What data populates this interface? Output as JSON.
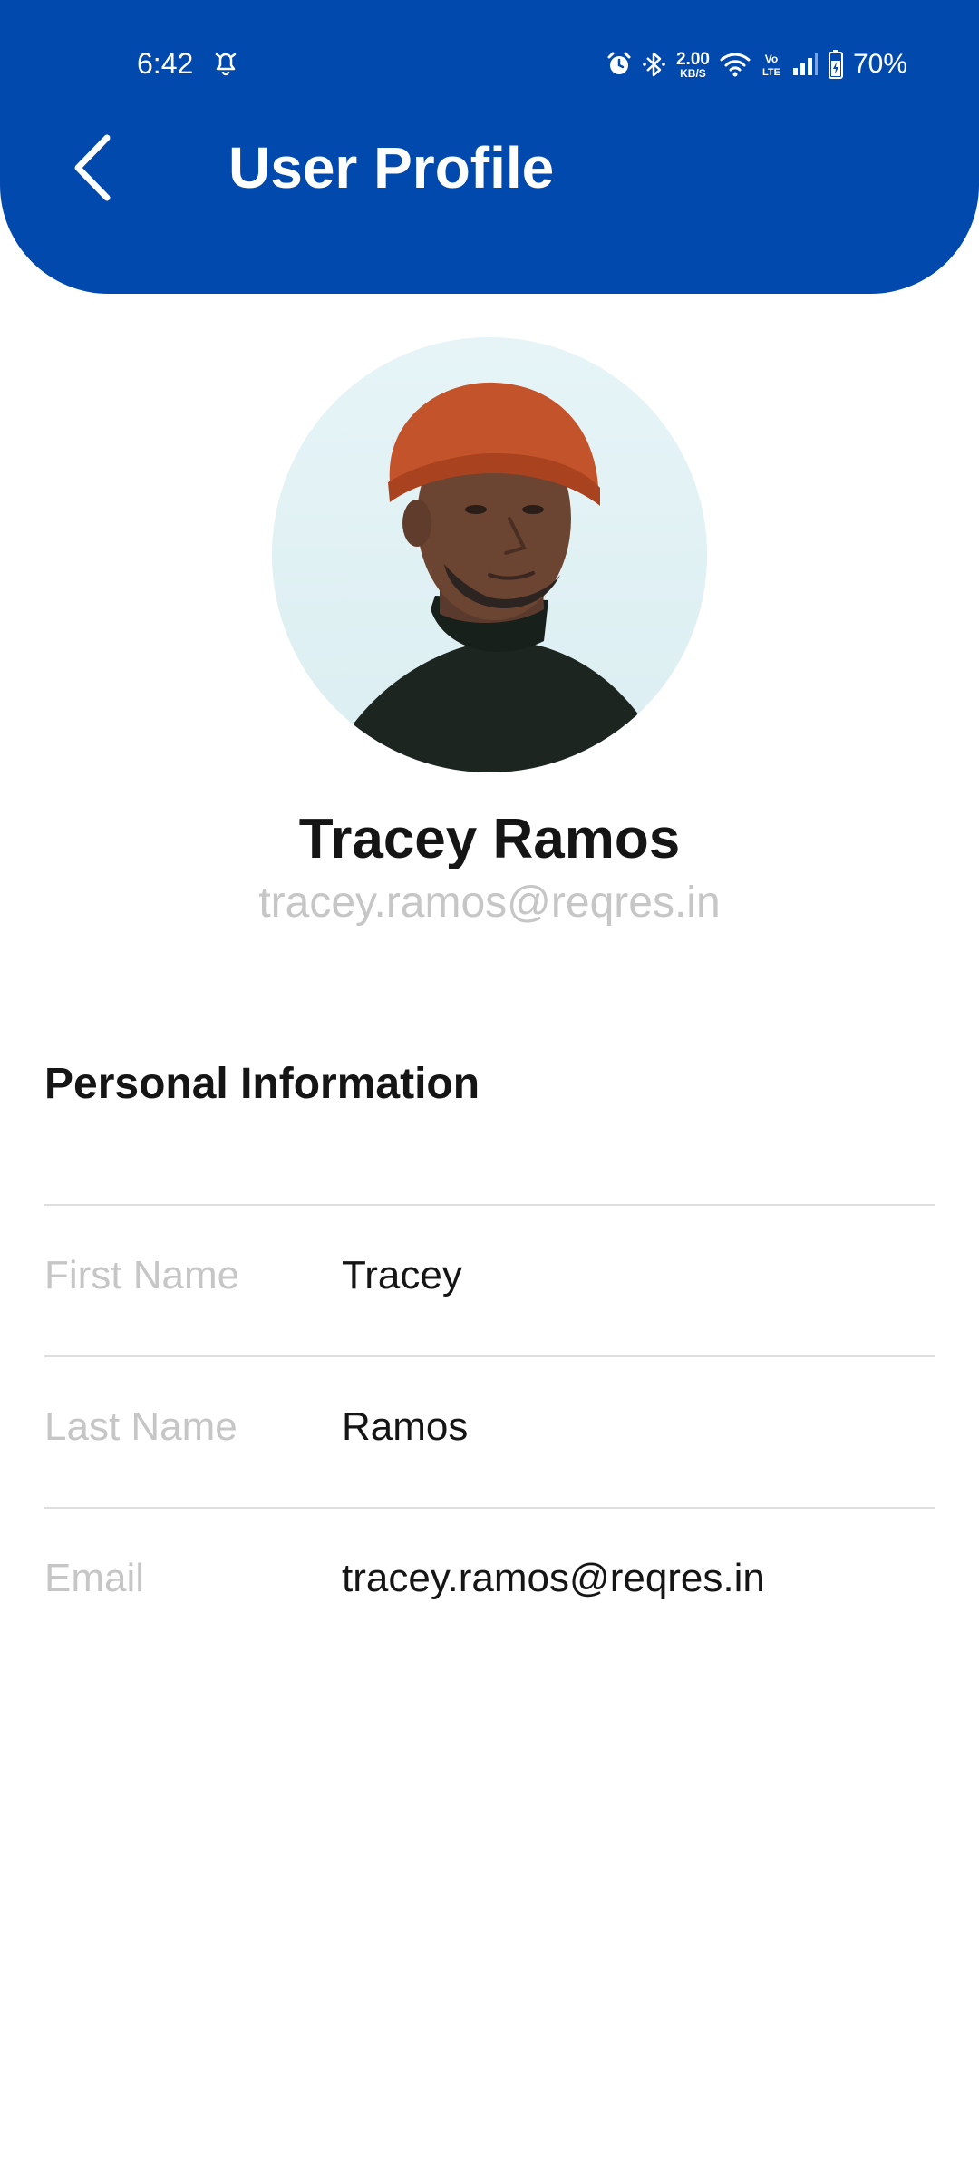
{
  "status_bar": {
    "time": "6:42",
    "notification_icon": "bell-icon",
    "alarm_icon": "alarm-icon",
    "bluetooth_icon": "bluetooth-icon",
    "data_rate_value": "2.00",
    "data_rate_unit": "KB/S",
    "wifi_icon": "wifi-icon",
    "volte_label": "Vo LTE",
    "signal_icon": "signal-icon",
    "battery_icon": "battery-charging-icon",
    "battery_percent": "70%"
  },
  "header": {
    "title": "User Profile",
    "back_icon": "chevron-left-icon",
    "background_color": "#0249ae"
  },
  "profile": {
    "name": "Tracey Ramos",
    "email": "tracey.ramos@reqres.in",
    "avatar": "avatar-photo"
  },
  "personal_info": {
    "section_title": "Personal Information",
    "rows": [
      {
        "label": "First Name",
        "value": "Tracey"
      },
      {
        "label": "Last Name",
        "value": "Ramos"
      },
      {
        "label": "Email",
        "value": "tracey.ramos@reqres.in"
      }
    ]
  }
}
